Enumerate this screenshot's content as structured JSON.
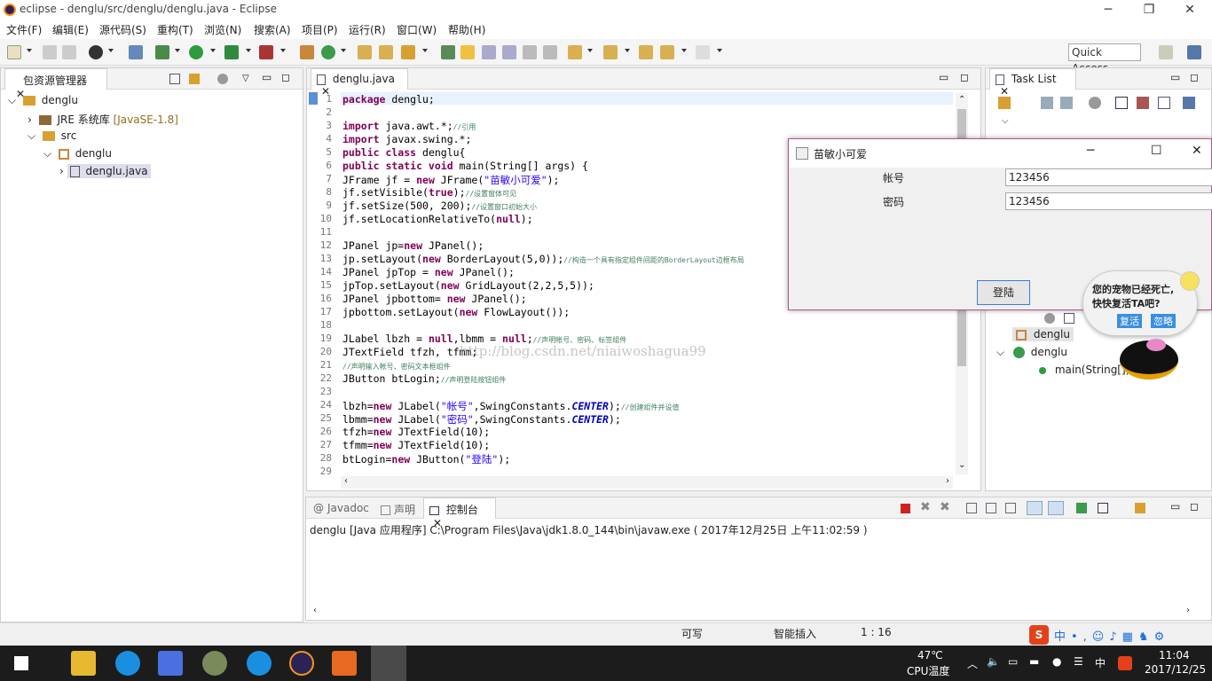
{
  "window": {
    "title": "eclipse - denglu/src/denglu/denglu.java - Eclipse"
  },
  "menu": [
    "文件(F)",
    "编辑(E)",
    "源代码(S)",
    "重构(T)",
    "浏览(N)",
    "搜索(A)",
    "项目(P)",
    "运行(R)",
    "窗口(W)",
    "帮助(H)"
  ],
  "quick_access": "Quick Access",
  "explorer": {
    "tab": "包资源管理器",
    "items": [
      "denglu",
      "JRE 系统库",
      "[JavaSE-1.8]",
      "src",
      "denglu",
      "denglu.java"
    ]
  },
  "editor": {
    "tab": "denglu.java",
    "line_numbers": [
      "1",
      "2",
      "3",
      "4",
      "5",
      "6",
      "7",
      "8",
      "9",
      "10",
      "11",
      "12",
      "13",
      "14",
      "15",
      "16",
      "17",
      "18",
      "19",
      "20",
      "21",
      "22",
      "23",
      "24",
      "25",
      "26",
      "27",
      "28",
      "29"
    ],
    "watermark": "http://blog.csdn.net/niaiwoshagua99"
  },
  "tasklist": {
    "tab": "Task List",
    "outline": [
      "denglu",
      "denglu",
      "main(String[])"
    ]
  },
  "jframe": {
    "title": "苗敏小可爱",
    "account_label": "帐号",
    "account_value": "123456",
    "password_label": "密码",
    "password_value": "123456",
    "login_button": "登陆"
  },
  "pet": {
    "line1": "您的宠物已经死亡,",
    "line2": "快快复活TA吧?",
    "revive": "复活",
    "ignore": "忽略"
  },
  "console": {
    "tabs": [
      "Javadoc",
      "声明",
      "控制台"
    ],
    "line": "denglu [Java 应用程序] C:\\Program Files\\Java\\jdk1.8.0_144\\bin\\javaw.exe ( 2017年12月25日 上午11:02:59 )"
  },
  "status": {
    "writable": "可写",
    "insert": "智能插入",
    "position": "1 : 16"
  },
  "taskbar": {
    "temp": "47℃",
    "temp_label": "CPU温度",
    "time": "11:04",
    "date": "2017/12/25",
    "ime": "中"
  }
}
